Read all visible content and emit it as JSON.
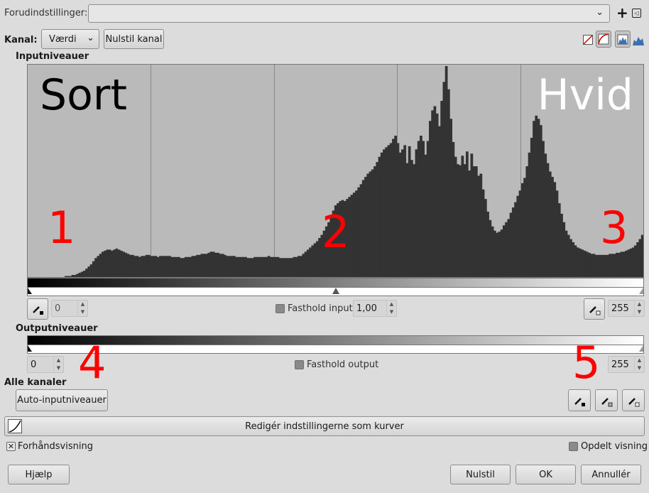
{
  "presets": {
    "label": "Forudindstillinger:",
    "value": ""
  },
  "channel": {
    "label": "Kanal:",
    "value": "Værdi",
    "reset_label": "Nulstil kanal"
  },
  "input_levels": {
    "title": "Inputniveauer",
    "overlay_black": "Sort",
    "overlay_white": "Hvid",
    "low_value": "0",
    "gamma_label": "Fasthold input",
    "gamma_value": "1,00",
    "high_value": "255"
  },
  "output_levels": {
    "title": "Outputniveauer",
    "low_value": "0",
    "keep_label": "Fasthold output",
    "high_value": "255"
  },
  "all_channels": {
    "title": "Alle kanaler",
    "auto_label": "Auto-inputniveauer"
  },
  "edit_curves_label": "Redigér indstillingerne som kurver",
  "preview_label": "Forhåndsvisning",
  "split_view_label": "Opdelt visning",
  "buttons": {
    "help": "Hjælp",
    "reset": "Nulstil",
    "ok": "OK",
    "cancel": "Annullér"
  },
  "annotations": [
    "1",
    "2",
    "3",
    "4",
    "5"
  ],
  "colors": {
    "annotation": "#ff0000",
    "histogram_fill": "#333333",
    "histogram_bg": "#bababa"
  },
  "histogram": [
    0,
    0,
    0,
    0,
    0,
    0,
    0,
    0,
    0,
    0,
    0,
    0,
    0,
    0,
    0,
    0,
    1,
    1,
    1,
    2,
    2,
    3,
    4,
    5,
    6,
    8,
    10,
    12,
    15,
    18,
    20,
    22,
    24,
    25,
    26,
    26,
    25,
    26,
    27,
    26,
    25,
    24,
    23,
    22,
    21,
    21,
    20,
    20,
    19,
    20,
    20,
    21,
    21,
    20,
    20,
    20,
    19,
    20,
    20,
    20,
    20,
    20,
    19,
    19,
    19,
    19,
    18,
    18,
    19,
    19,
    19,
    20,
    20,
    21,
    21,
    22,
    22,
    22,
    23,
    24,
    24,
    23,
    23,
    22,
    22,
    21,
    20,
    20,
    20,
    20,
    19,
    19,
    19,
    19,
    19,
    18,
    18,
    18,
    19,
    19,
    19,
    19,
    19,
    19,
    20,
    19,
    19,
    19,
    19,
    18,
    18,
    18,
    18,
    18,
    18,
    19,
    19,
    20,
    20,
    22,
    24,
    26,
    28,
    30,
    32,
    34,
    37,
    40,
    44,
    48,
    52,
    58,
    63,
    68,
    70,
    72,
    73,
    72,
    74,
    76,
    78,
    80,
    82,
    85,
    88,
    92,
    95,
    98,
    100,
    102,
    105,
    109,
    114,
    118,
    121,
    123,
    125,
    127,
    131,
    134,
    127,
    118,
    121,
    125,
    108,
    124,
    111,
    107,
    121,
    129,
    134,
    129,
    116,
    129,
    148,
    158,
    162,
    155,
    143,
    167,
    185,
    200,
    178,
    150,
    128,
    114,
    107,
    106,
    115,
    107,
    119,
    101,
    117,
    105,
    105,
    96,
    98,
    83,
    74,
    62,
    54,
    48,
    44,
    42,
    43,
    45,
    49,
    52,
    55,
    61,
    66,
    71,
    77,
    82,
    89,
    94,
    105,
    118,
    132,
    148,
    153,
    150,
    144,
    129,
    117,
    108,
    100,
    95,
    90,
    82,
    70,
    60,
    52,
    44,
    40,
    36,
    33,
    30,
    28,
    27,
    26,
    25,
    24,
    23,
    22,
    22,
    21,
    21,
    21,
    21,
    21,
    21,
    22,
    22,
    22,
    23,
    23,
    24,
    24,
    25,
    26,
    27,
    28,
    30,
    33,
    36,
    40
  ]
}
